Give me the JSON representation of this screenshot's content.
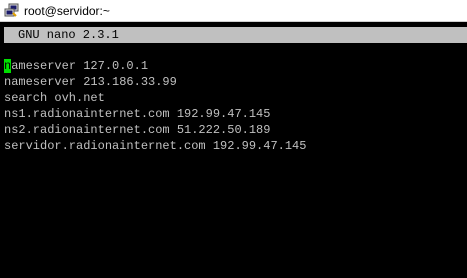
{
  "window": {
    "title": "root@servidor:~",
    "icon": "putty-icon"
  },
  "nano": {
    "header": "GNU nano 2.3.1"
  },
  "editor": {
    "cursor_char": "n",
    "first_line_rest": "ameserver 127.0.0.1",
    "lines": [
      "nameserver 127.0.0.1",
      "nameserver 213.186.33.99",
      "search ovh.net",
      "ns1.radionainternet.com 192.99.47.145",
      "ns2.radionainternet.com 51.222.50.189",
      "servidor.radionainternet.com 192.99.47.145"
    ]
  },
  "colors": {
    "background": "#000000",
    "text": "#c0c0c0",
    "header_bg": "#c0c0c0",
    "cursor": "#00e000"
  }
}
